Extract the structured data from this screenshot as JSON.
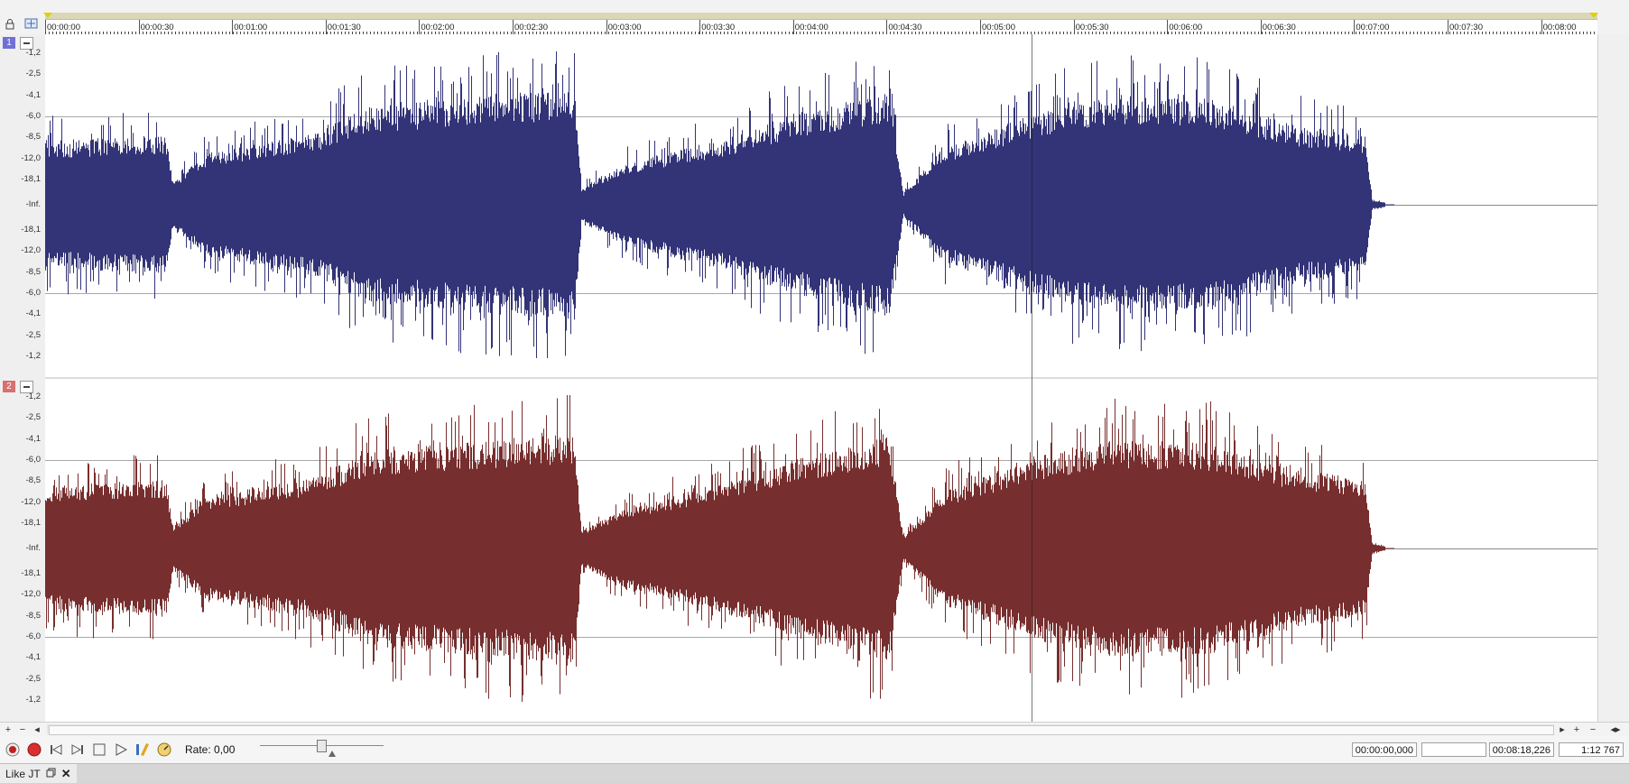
{
  "ruler": {
    "labels": [
      "00:00:00",
      "00:00:30",
      "00:01:00",
      "00:01:30",
      "00:02:00",
      "00:02:30",
      "00:03:00",
      "00:03:30",
      "00:04:00",
      "00:04:30",
      "00:05:00",
      "00:05:30",
      "00:06:00",
      "00:06:30",
      "00:07:00",
      "00:07:30",
      "00:08:00"
    ]
  },
  "channels": [
    {
      "number": "1",
      "badge_color": "#7070d8",
      "wave_color": "#333377",
      "db_labels": [
        "-1,2",
        "-2,5",
        "-4,1",
        "-6,0",
        "-8,5",
        "-12,0",
        "-18,1",
        "-Inf.",
        "-18,1",
        "-12,0",
        "-8,5",
        "-6,0",
        "-4,1",
        "-2,5",
        "-1,2"
      ]
    },
    {
      "number": "2",
      "badge_color": "#d87070",
      "wave_color": "#772e2e",
      "db_labels": [
        "-1,2",
        "-2,5",
        "-4,1",
        "-6,0",
        "-8,5",
        "-12,0",
        "-18,1",
        "-Inf.",
        "-18,1",
        "-12,0",
        "-8,5",
        "-6,0",
        "-4,1",
        "-2,5",
        "-1,2"
      ]
    }
  ],
  "transport": {
    "rate_label": "Rate: 0,00",
    "time_cursor": "00:00:00,000",
    "time_selection": "",
    "time_length": "00:08:18,226",
    "zoom": "1:12 767"
  },
  "tab": {
    "title": "Like JT"
  },
  "icons": {
    "lock": "lock-icon",
    "channels": "channels-icon",
    "record_arm": "record-arm-icon",
    "record": "record-icon",
    "go_start": "go-to-start-icon",
    "go_end": "go-to-end-icon",
    "stop": "stop-icon",
    "play": "play-icon",
    "play_looped": "play-looped-icon",
    "metronome": "metronome-icon",
    "restore": "restore-icon",
    "close": "close-icon"
  }
}
